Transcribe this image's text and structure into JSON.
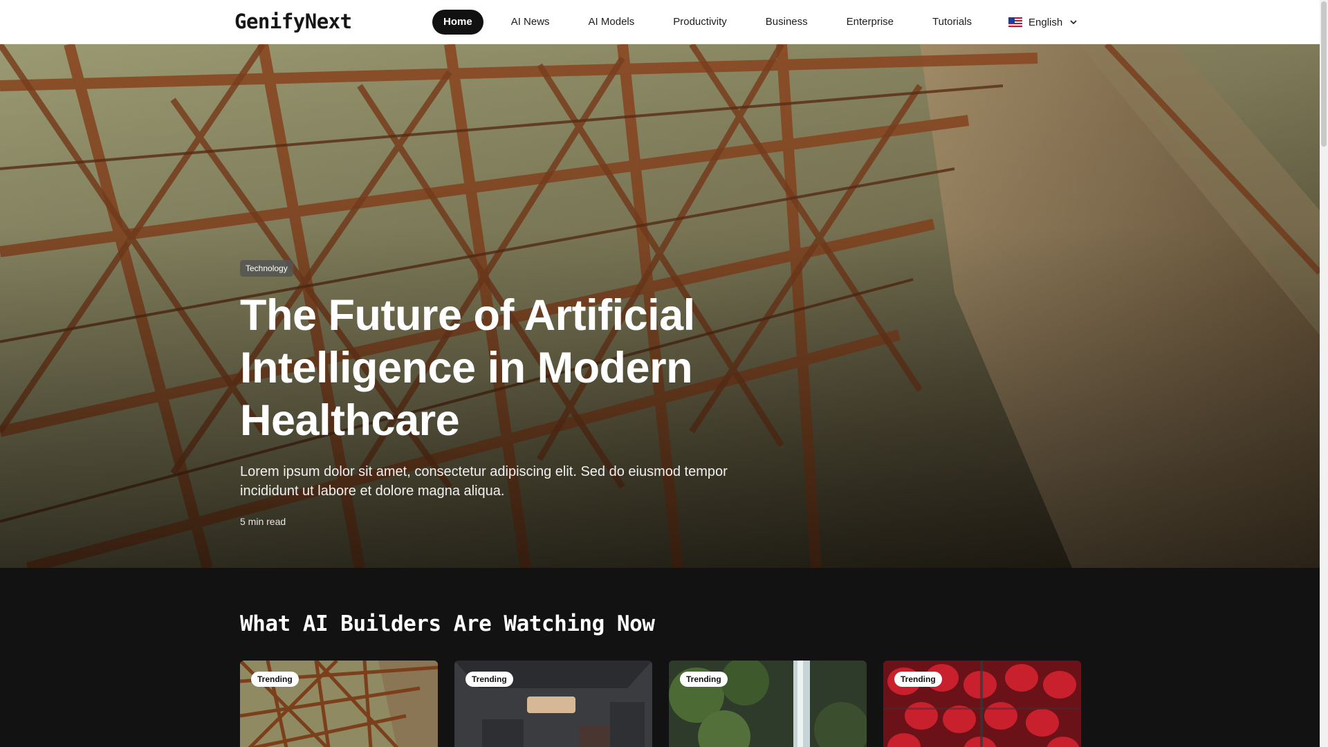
{
  "brand": {
    "logo": "GenifyNext"
  },
  "nav": {
    "links": [
      {
        "label": "Home",
        "active": true
      },
      {
        "label": "AI News"
      },
      {
        "label": "AI Models"
      },
      {
        "label": "Productivity"
      },
      {
        "label": "Business"
      },
      {
        "label": "Enterprise"
      },
      {
        "label": "Tutorials"
      }
    ],
    "language": {
      "label": "English",
      "flag_icon": "us-flag-icon"
    }
  },
  "hero": {
    "tag": "Technology",
    "title": "The Future of Artificial Intelligence in Modern Healthcare",
    "description": "Lorem ipsum dolor sit amet, consectetur adipiscing elit. Sed do eiusmod tempor incididunt ut labore et dolore magna aliqua.",
    "read_time": "5 min read"
  },
  "trending": {
    "heading": "What AI Builders Are Watching Now",
    "cards": [
      {
        "badge": "Trending"
      },
      {
        "badge": "Trending"
      },
      {
        "badge": "Trending"
      },
      {
        "badge": "Trending"
      }
    ]
  },
  "colors": {
    "nav_bg": "#ffffff",
    "active_pill": "#111111",
    "page_dark": "#121212",
    "steel": "#8a4a24"
  }
}
